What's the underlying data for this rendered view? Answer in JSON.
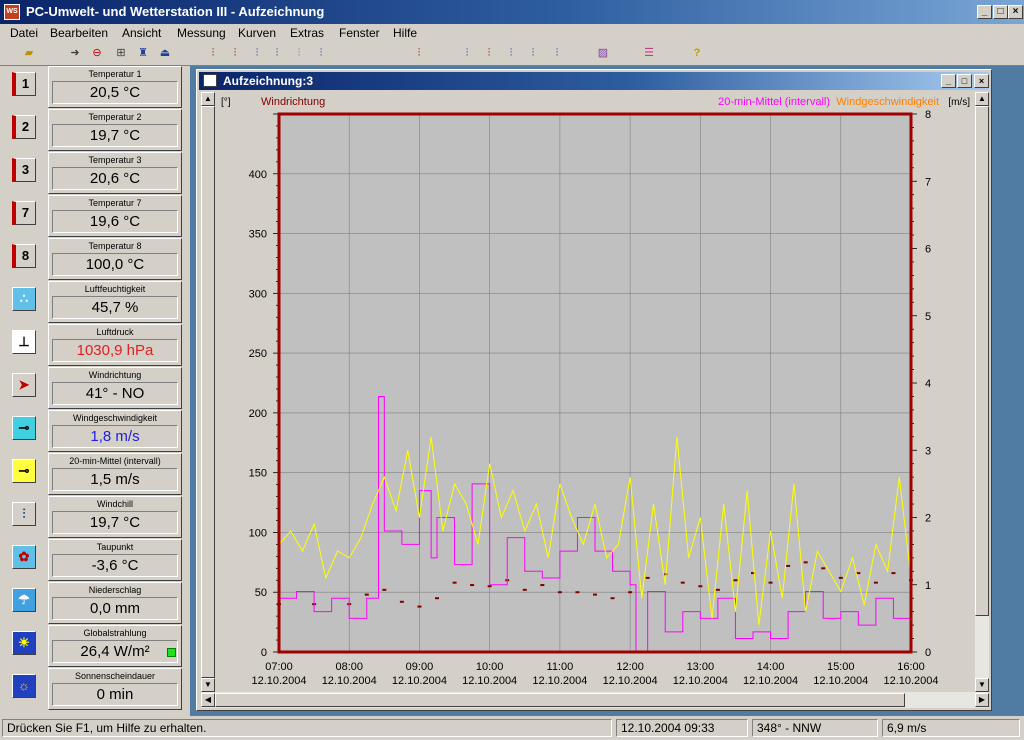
{
  "app": {
    "title": "PC-Umwelt- und Wetterstation III - Aufzeichnung",
    "icon_text": "WS"
  },
  "menu": [
    "Datei",
    "Bearbeiten",
    "Ansicht",
    "Messung",
    "Kurven",
    "Extras",
    "Fenster",
    "Hilfe"
  ],
  "toolbar": {
    "icons": [
      "folder-open-icon",
      "arrow-right-icon",
      "stop-icon",
      "record-icon",
      "station-icon",
      "export-icon",
      "curve-1-icon",
      "curve-2-icon",
      "curve-3-icon",
      "curve-4-icon",
      "curve-5-icon",
      "curve-6-icon",
      "curve-7-icon",
      "curve-8-icon",
      "curve-9-icon",
      "curve-10-icon",
      "graph-icon",
      "legend-icon",
      "help-icon"
    ]
  },
  "sensors": [
    {
      "icon": "1",
      "label": "Temperatur 1",
      "value": "20,5 °C",
      "color": "#000000"
    },
    {
      "icon": "2",
      "label": "Temperatur 2",
      "value": "19,7 °C",
      "color": "#000000"
    },
    {
      "icon": "3",
      "label": "Temperatur 3",
      "value": "20,6 °C",
      "color": "#000000"
    },
    {
      "icon": "7",
      "label": "Temperatur 7",
      "value": "19,6 °C",
      "color": "#000000"
    },
    {
      "icon": "8",
      "label": "Temperatur 8",
      "value": "100,0 °C",
      "color": "#000000"
    },
    {
      "icon": "",
      "label": "Luftfeuchtigkeit",
      "value": "45,7 %",
      "color": "#000000"
    },
    {
      "icon": "",
      "label": "Luftdruck",
      "value": "1030,9 hPa",
      "color": "#e02020"
    },
    {
      "icon": "",
      "label": "Windrichtung",
      "value": "41° - NO",
      "color": "#000000"
    },
    {
      "icon": "",
      "label": "Windgeschwindigkeit",
      "value": "1,8 m/s",
      "color": "#2020e0"
    },
    {
      "icon": "",
      "label": "20-min-Mittel (intervall)",
      "value": "1,5 m/s",
      "color": "#000000"
    },
    {
      "icon": "",
      "label": "Windchill",
      "value": "19,7 °C",
      "color": "#000000"
    },
    {
      "icon": "",
      "label": "Taupunkt",
      "value": "-3,6 °C",
      "color": "#000000"
    },
    {
      "icon": "",
      "label": "Niederschlag",
      "value": "0,0 mm",
      "color": "#000000"
    },
    {
      "icon": "",
      "label": "Globalstrahlung",
      "value": "26,4 W/m²",
      "color": "#000000"
    },
    {
      "icon": "",
      "label": "Sonnenscheindauer",
      "value": "0 min",
      "color": "#000000"
    }
  ],
  "child_window": {
    "title": "Aufzeichnung:3"
  },
  "chart": {
    "left_unit": "[°]",
    "left_series": "Windrichtung",
    "right_series_1": "20-min-Mittel (intervall)",
    "right_series_2": "Windgeschwindigkeit",
    "right_unit": "[m/s]",
    "colors": {
      "plot_bg": "#c0c0c0",
      "frame": "#a00000",
      "direction": "#800000",
      "mean": "#ff00ff",
      "speed": "#ffff00",
      "grid": "#808080"
    }
  },
  "chart_data": {
    "type": "line",
    "x_labels": [
      {
        "time": "07:00",
        "date": "12.10.2004"
      },
      {
        "time": "08:00",
        "date": "12.10.2004"
      },
      {
        "time": "09:00",
        "date": "12.10.2004"
      },
      {
        "time": "10:00",
        "date": "12.10.2004"
      },
      {
        "time": "11:00",
        "date": "12.10.2004"
      },
      {
        "time": "12:00",
        "date": "12.10.2004"
      },
      {
        "time": "13:00",
        "date": "12.10.2004"
      },
      {
        "time": "14:00",
        "date": "12.10.2004"
      },
      {
        "time": "15:00",
        "date": "12.10.2004"
      },
      {
        "time": "16:00",
        "date": "12.10.2004"
      }
    ],
    "xlim": [
      "07:00",
      "16:00"
    ],
    "y_left": {
      "label": "Windrichtung",
      "unit": "[°]",
      "ylim": [
        0,
        450
      ],
      "ticks": [
        0,
        50,
        100,
        150,
        200,
        250,
        300,
        350,
        400
      ]
    },
    "y_right": {
      "unit": "[m/s]",
      "ylim": [
        0,
        8
      ],
      "ticks": [
        0,
        1,
        2,
        3,
        4,
        5,
        6,
        7,
        8
      ]
    },
    "grid": true,
    "series": [
      {
        "name": "Windrichtung",
        "axis": "left",
        "style": "dots",
        "x": [
          "07:00",
          "07:30",
          "08:00",
          "08:15",
          "08:30",
          "08:45",
          "09:00",
          "09:15",
          "09:30",
          "09:45",
          "10:00",
          "10:15",
          "10:30",
          "10:45",
          "11:00",
          "11:15",
          "11:30",
          "11:45",
          "12:00",
          "12:15",
          "12:30",
          "12:45",
          "13:00",
          "13:15",
          "13:30",
          "13:45",
          "14:00",
          "14:15",
          "14:30",
          "14:45",
          "15:00",
          "15:15",
          "15:30",
          "15:45",
          "16:00"
        ],
        "y": [
          40,
          40,
          40,
          48,
          52,
          42,
          38,
          45,
          58,
          56,
          55,
          60,
          52,
          56,
          50,
          50,
          48,
          45,
          50,
          62,
          65,
          58,
          55,
          52,
          60,
          66,
          58,
          72,
          75,
          70,
          62,
          66,
          58,
          66,
          60
        ]
      },
      {
        "name": "20-min-Mittel (intervall)",
        "axis": "right",
        "style": "step",
        "x": [
          "07:00",
          "07:15",
          "07:30",
          "07:45",
          "08:00",
          "08:15",
          "08:25",
          "08:30",
          "08:45",
          "09:00",
          "09:10",
          "09:15",
          "09:30",
          "09:45",
          "10:00",
          "10:15",
          "10:30",
          "10:45",
          "11:00",
          "11:15",
          "11:30",
          "11:45",
          "12:00",
          "12:05",
          "12:15",
          "12:30",
          "12:45",
          "13:00",
          "13:15",
          "13:30",
          "13:45",
          "14:00",
          "14:15",
          "14:30",
          "14:45",
          "15:00",
          "15:15",
          "15:30",
          "15:45",
          "16:00"
        ],
        "y": [
          0.8,
          0.9,
          0.6,
          0.8,
          0.5,
          0.8,
          3.8,
          1.8,
          1.6,
          2.4,
          1.4,
          2.0,
          1.3,
          2.5,
          1.0,
          1.7,
          1.2,
          1.1,
          1.5,
          2.0,
          1.5,
          1.2,
          1.0,
          0.0,
          0.9,
          0.3,
          0.6,
          0.5,
          0.8,
          0.2,
          0.3,
          0.2,
          0.6,
          0.9,
          0.5,
          0.6,
          0.4,
          0.8,
          0.5,
          1.4
        ]
      },
      {
        "name": "Windgeschwindigkeit",
        "axis": "right",
        "style": "line",
        "x": [
          "07:00",
          "07:10",
          "07:20",
          "07:30",
          "07:40",
          "07:50",
          "08:00",
          "08:10",
          "08:20",
          "08:30",
          "08:40",
          "08:50",
          "09:00",
          "09:10",
          "09:20",
          "09:30",
          "09:40",
          "09:50",
          "10:00",
          "10:10",
          "10:20",
          "10:30",
          "10:40",
          "10:50",
          "11:00",
          "11:10",
          "11:20",
          "11:30",
          "11:40",
          "11:50",
          "12:00",
          "12:10",
          "12:20",
          "12:30",
          "12:40",
          "12:50",
          "13:00",
          "13:10",
          "13:20",
          "13:30",
          "13:40",
          "13:50",
          "14:00",
          "14:10",
          "14:20",
          "14:30",
          "14:40",
          "14:50",
          "15:00",
          "15:10",
          "15:20",
          "15:30",
          "15:40",
          "15:50",
          "16:00"
        ],
        "y": [
          1.6,
          1.8,
          1.5,
          1.9,
          1.1,
          1.5,
          1.4,
          1.7,
          2.2,
          2.6,
          2.1,
          3.0,
          2.0,
          3.2,
          1.8,
          2.5,
          2.2,
          1.6,
          2.8,
          2.0,
          2.4,
          1.8,
          2.2,
          1.4,
          2.5,
          2.0,
          1.6,
          2.2,
          1.4,
          1.6,
          2.6,
          0.8,
          2.2,
          1.0,
          3.2,
          1.4,
          2.0,
          0.5,
          2.2,
          0.6,
          2.4,
          0.4,
          1.8,
          0.8,
          2.5,
          0.6,
          1.5,
          1.2,
          0.9,
          1.4,
          0.7,
          1.6,
          1.2,
          2.6,
          1.1
        ]
      }
    ]
  },
  "status": {
    "help": "Drücken Sie F1, um Hilfe zu erhalten.",
    "datetime": "12.10.2004  09:33",
    "direction": "348° - NNW",
    "speed": "6,9 m/s"
  }
}
